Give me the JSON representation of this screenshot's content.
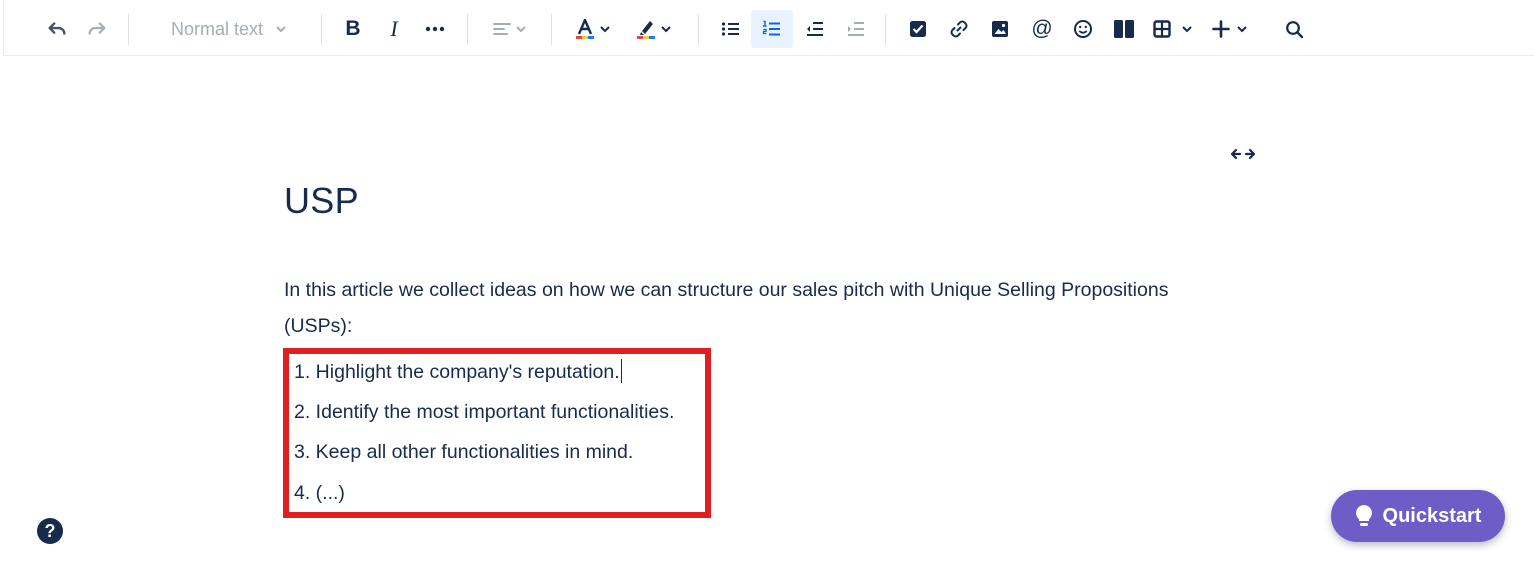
{
  "toolbar": {
    "text_style": "Normal text",
    "icons": {
      "undo": "undo-icon",
      "redo": "redo-icon",
      "bold": "B",
      "italic": "I",
      "more": "more-formatting-icon",
      "align": "align-left-icon",
      "text_color": "text-color-icon",
      "highlight": "highlight-icon",
      "bullet_list": "bullet-list-icon",
      "numbered_list": "numbered-list-icon",
      "outdent": "outdent-icon",
      "indent": "indent-icon",
      "action_item": "checkbox-icon",
      "link": "link-icon",
      "image": "image-icon",
      "mention": "@",
      "emoji": "emoji-icon",
      "layouts": "layouts-icon",
      "table": "table-icon",
      "insert": "plus-icon",
      "find": "search-icon"
    },
    "colors": {
      "active_bg": "#e9f2ff",
      "active_fg": "#0c66e4"
    }
  },
  "page": {
    "title": "USP",
    "intro": "In this article we collect ideas on how we can structure our sales pitch with Unique Selling Propositions (USPs):",
    "list_items": [
      "1. Highlight the company's reputation.",
      "2. Identify the most important functionalities.",
      "3. Keep all other functionalities in mind.",
      "4. (...)"
    ],
    "highlight_color": "#e02020"
  },
  "help": {
    "label": "?"
  },
  "quickstart": {
    "label": "Quickstart",
    "color": "#6e5dc6"
  }
}
